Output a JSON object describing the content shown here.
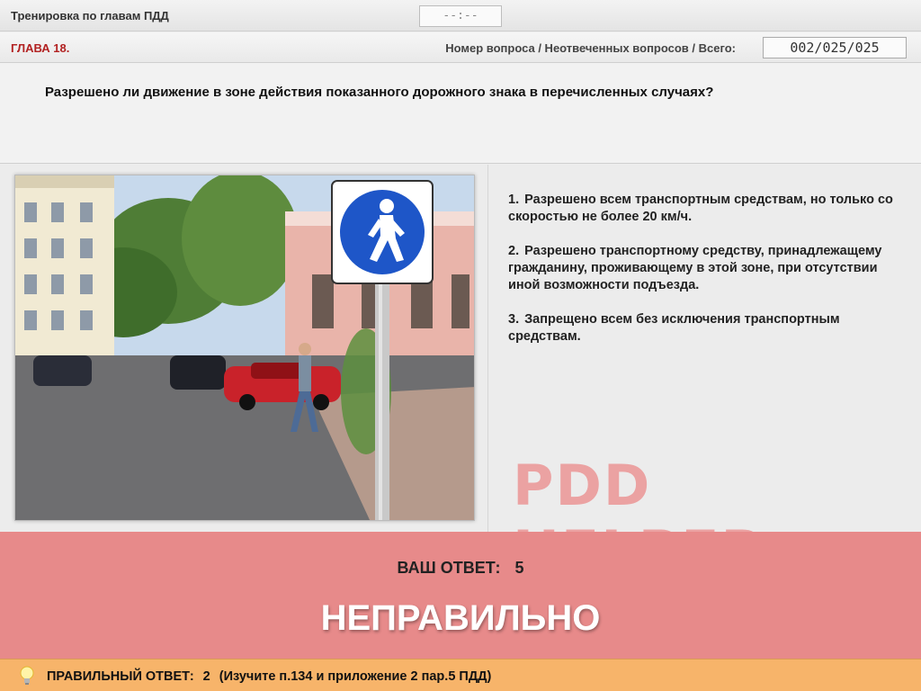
{
  "header": {
    "title": "Тренировка по главам ПДД",
    "timer": "--:--"
  },
  "chapter_bar": {
    "chapter": "ГЛАВА 18.",
    "counter_label": "Номер вопроса / Неотвеченных вопросов / Всего:",
    "counter_value": "002/025/025"
  },
  "question": {
    "text": "Разрешено ли движение в зоне действия показанного дорожного знака в перечисленных случаях?"
  },
  "answers": [
    {
      "num": "1.",
      "text": "Разрешено всем транспортным средствам, но только со скоростью не более 20 км/ч."
    },
    {
      "num": "2.",
      "text": "Разрешено транспортному средству, принадлежащему гражданину, проживающему в этой зоне, при отсутствии иной возможности подъезда."
    },
    {
      "num": "3.",
      "text": "Запрещено всем без исключения транспортным средствам."
    }
  ],
  "watermark": "PDD HELPER",
  "result": {
    "your_answer_label": "ВАШ ОТВЕТ:",
    "your_answer_value": "5",
    "verdict": "НЕПРАВИЛЬНО",
    "verdict_color": "#e78a8a"
  },
  "correct": {
    "label": "ПРАВИЛЬНЫЙ ОТВЕТ:",
    "value": "2",
    "hint": "(Изучите п.134 и приложение 2 пар.5 ПДД)",
    "bar_color": "#f7b46a"
  }
}
